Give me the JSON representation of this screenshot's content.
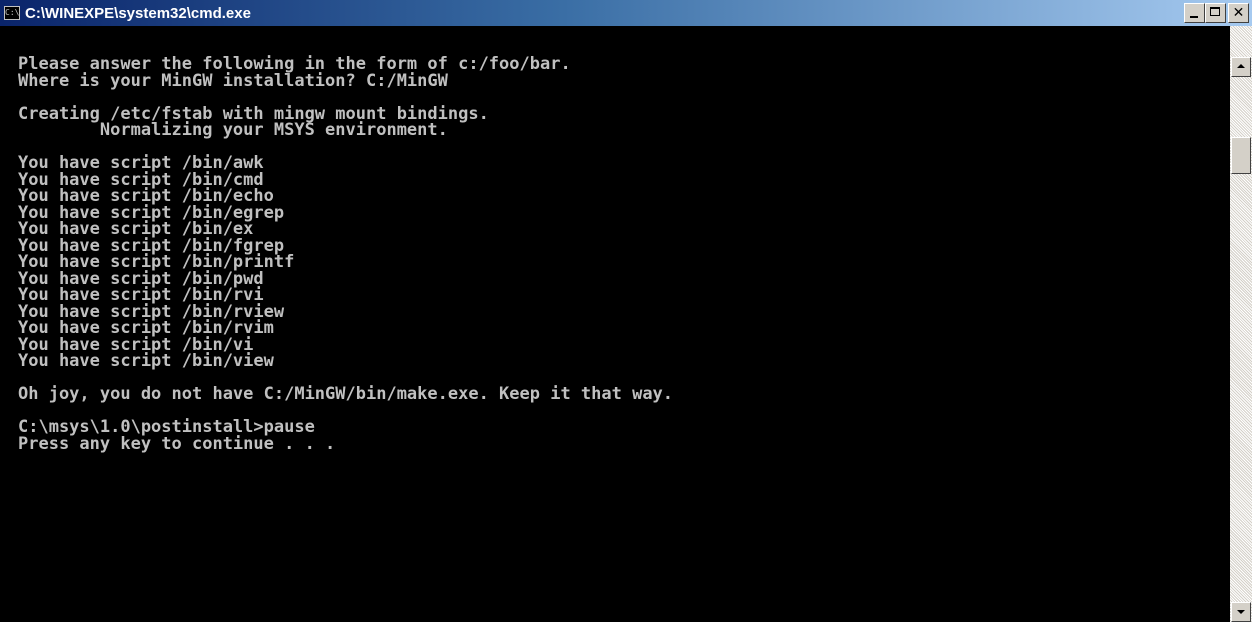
{
  "window": {
    "title": "C:\\WINEXPE\\system32\\cmd.exe",
    "icon": "console-icon",
    "icon_label": "C:\\",
    "controls": [
      "minimize",
      "maximize",
      "close"
    ]
  },
  "console": {
    "background_color": "#000000",
    "text_color": "#c0c0c0",
    "lines": [
      "Please answer the following in the form of c:/foo/bar.",
      "Where is your MinGW installation? C:/MinGW",
      "",
      "Creating /etc/fstab with mingw mount bindings.",
      "        Normalizing your MSYS environment.",
      "",
      "You have script /bin/awk",
      "You have script /bin/cmd",
      "You have script /bin/echo",
      "You have script /bin/egrep",
      "You have script /bin/ex",
      "You have script /bin/fgrep",
      "You have script /bin/printf",
      "You have script /bin/pwd",
      "You have script /bin/rvi",
      "You have script /bin/rview",
      "You have script /bin/rvim",
      "You have script /bin/vi",
      "You have script /bin/view",
      "",
      "Oh joy, you do not have C:/MinGW/bin/make.exe. Keep it that way.",
      "",
      "C:\\msys\\1.0\\postinstall>pause",
      "Press any key to continue . . ."
    ]
  },
  "scrollbar": {
    "up_icon": "scroll-up-arrow-icon",
    "down_icon": "scroll-down-arrow-icon"
  }
}
